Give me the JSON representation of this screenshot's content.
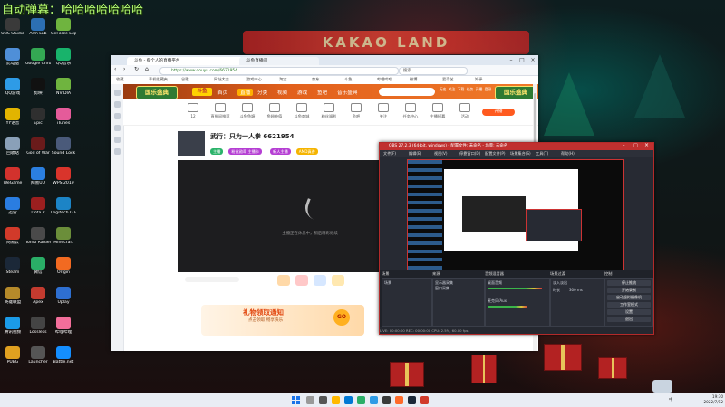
{
  "overlay": {
    "stream_title": "自动弹幕：哈哈哈哈哈哈哈"
  },
  "wallpaper": {
    "banner_text": "KAKAO    LAND"
  },
  "desktop": {
    "icons": [
      {
        "label": "OBS Studio",
        "color": "#3a3a3a"
      },
      {
        "label": "此电脑",
        "color": "#4f8fd8"
      },
      {
        "label": "QQ游戏",
        "color": "#2e9be6"
      },
      {
        "label": "YY语音",
        "color": "#e2b400"
      },
      {
        "label": "回收站",
        "color": "#8aa0b8"
      },
      {
        "label": "WeGame",
        "color": "#d2322d"
      },
      {
        "label": "迅雷",
        "color": "#2a7de1"
      },
      {
        "label": "网易云",
        "color": "#d13a2a"
      },
      {
        "label": "Steam",
        "color": "#1b2838"
      },
      {
        "label": "英雄联盟",
        "color": "#b58a2a"
      },
      {
        "label": "腾讯视频",
        "color": "#1b9be8"
      },
      {
        "label": "PUBG",
        "color": "#e0a020"
      },
      {
        "label": "Arm Lab",
        "color": "#2c6fb3"
      },
      {
        "label": "Google Chrome",
        "color": "#34a853"
      },
      {
        "label": "剪映",
        "color": "#111111"
      },
      {
        "label": "Epic",
        "color": "#2f2f2f"
      },
      {
        "label": "God of War",
        "color": "#6a1b1b"
      },
      {
        "label": "网易UU",
        "color": "#2b7fe0"
      },
      {
        "label": "Dota 2",
        "color": "#9b1f1f"
      },
      {
        "label": "Tomb Raider",
        "color": "#4a4a4a"
      },
      {
        "label": "微信",
        "color": "#2aae67"
      },
      {
        "label": "Apex",
        "color": "#c33b2f"
      },
      {
        "label": "Lossless",
        "color": "#444444"
      },
      {
        "label": "Launcher",
        "color": "#555555"
      },
      {
        "label": "GeForce Experience",
        "color": "#6fb43f"
      },
      {
        "label": "QQ音乐",
        "color": "#18b36b"
      },
      {
        "label": "NVIDIA",
        "color": "#6fb43f"
      },
      {
        "label": "iTunes",
        "color": "#e55b9a"
      },
      {
        "label": "Sound Lock",
        "color": "#4a5a7a"
      },
      {
        "label": "WPS 2019",
        "color": "#d9342b"
      },
      {
        "label": "Logitech G HUB",
        "color": "#1c84c6"
      },
      {
        "label": "Minecraft",
        "color": "#6b8e3a"
      },
      {
        "label": "Origin",
        "color": "#f26a21"
      },
      {
        "label": "Uplay",
        "color": "#2e6fd0"
      },
      {
        "label": "哔哩哔哩",
        "color": "#f36e9a"
      },
      {
        "label": "Battle.net",
        "color": "#148eff"
      }
    ]
  },
  "browser": {
    "tab1": "斗鱼 - 每个人的直播平台",
    "tab2": "斗鱼直播间",
    "url": "https://www.douyu.com/6621954",
    "search_placeholder": "搜索",
    "bookmarks": [
      "收藏",
      "手机收藏夹",
      "谷歌",
      "网址大全",
      "游戏中心",
      "淘宝",
      "京东",
      "斗鱼",
      "哔哩哔哩",
      "微博",
      "爱奇艺",
      "知乎"
    ],
    "site": {
      "logo_text": "国乐盛典",
      "brand": "斗鱼",
      "nav": [
        "首页",
        "直播",
        "分类",
        "视频",
        "游戏",
        "鱼吧",
        "音乐盛典"
      ],
      "active_nav": 1,
      "nav_icons": [
        "历史",
        "关注",
        "下载",
        "任务",
        "开播",
        "登录"
      ],
      "categories": [
        {
          "label": "12",
          "sub": "主播等级"
        },
        {
          "label": "直播间推荐",
          "sub": ""
        },
        {
          "label": "斗鱼鱼塘",
          "sub": ""
        },
        {
          "label": "鱼翅充值",
          "sub": ""
        },
        {
          "label": "斗鱼商城",
          "sub": ""
        },
        {
          "label": "粉丝福利",
          "sub": ""
        },
        {
          "label": "鱼吧",
          "sub": ""
        },
        {
          "label": "关注",
          "sub": ""
        },
        {
          "label": "任务中心",
          "sub": ""
        },
        {
          "label": "主播招募",
          "sub": ""
        },
        {
          "label": "活动",
          "sub": ""
        }
      ],
      "live_button": "开播",
      "room": {
        "title": "武行：只为一人拳 6621954",
        "tags": [
          {
            "text": "主播",
            "color": "#2bb36a"
          },
          {
            "text": "粉丝勋章 主播卡",
            "color": "#b53fd3"
          },
          {
            "text": "新人主播",
            "color": "#b53fd3"
          },
          {
            "text": "AMD真香",
            "color": "#f5b400"
          }
        ],
        "video_message": "主播正在休息中，稍后精彩继续"
      },
      "gift_banner": {
        "title": "礼物领取通知",
        "sub": "点击领取 畅享快乐",
        "go": "GO"
      }
    }
  },
  "obs": {
    "title": "OBS 27.2.3 (64-bit, windows) - 配置文件: 未命名 - 场景: 未命名",
    "menu": [
      "文件(F)",
      "编辑(E)",
      "视图(V)",
      "停靠窗口(D)",
      "配置文件(P)",
      "场景集合(S)",
      "工具(T)",
      "帮助(H)"
    ],
    "docks": {
      "scenes_label": "场景",
      "sources_label": "来源",
      "mixer_label": "音频混音器",
      "transitions_label": "场景过渡",
      "controls_label": "控制",
      "scene_items": [
        "场景"
      ],
      "source_items": [
        "显示器采集",
        "窗口采集"
      ],
      "mixer_items": [
        "桌面音频",
        "麦克风/Aux"
      ],
      "transition_name": "淡入淡出",
      "duration_label": "时长",
      "duration_value": "300 ms",
      "controls": [
        "停止推流",
        "开始录制",
        "启动虚拟摄像机",
        "工作室模式",
        "设置",
        "退出"
      ]
    },
    "status": "LIVE: 00:00:00   REC: 00:00:00   CPU: 2.5%, 60.00 fps"
  },
  "taskbar": {
    "tray_text": "中",
    "time": "19:30",
    "date": "2022/7/12"
  }
}
